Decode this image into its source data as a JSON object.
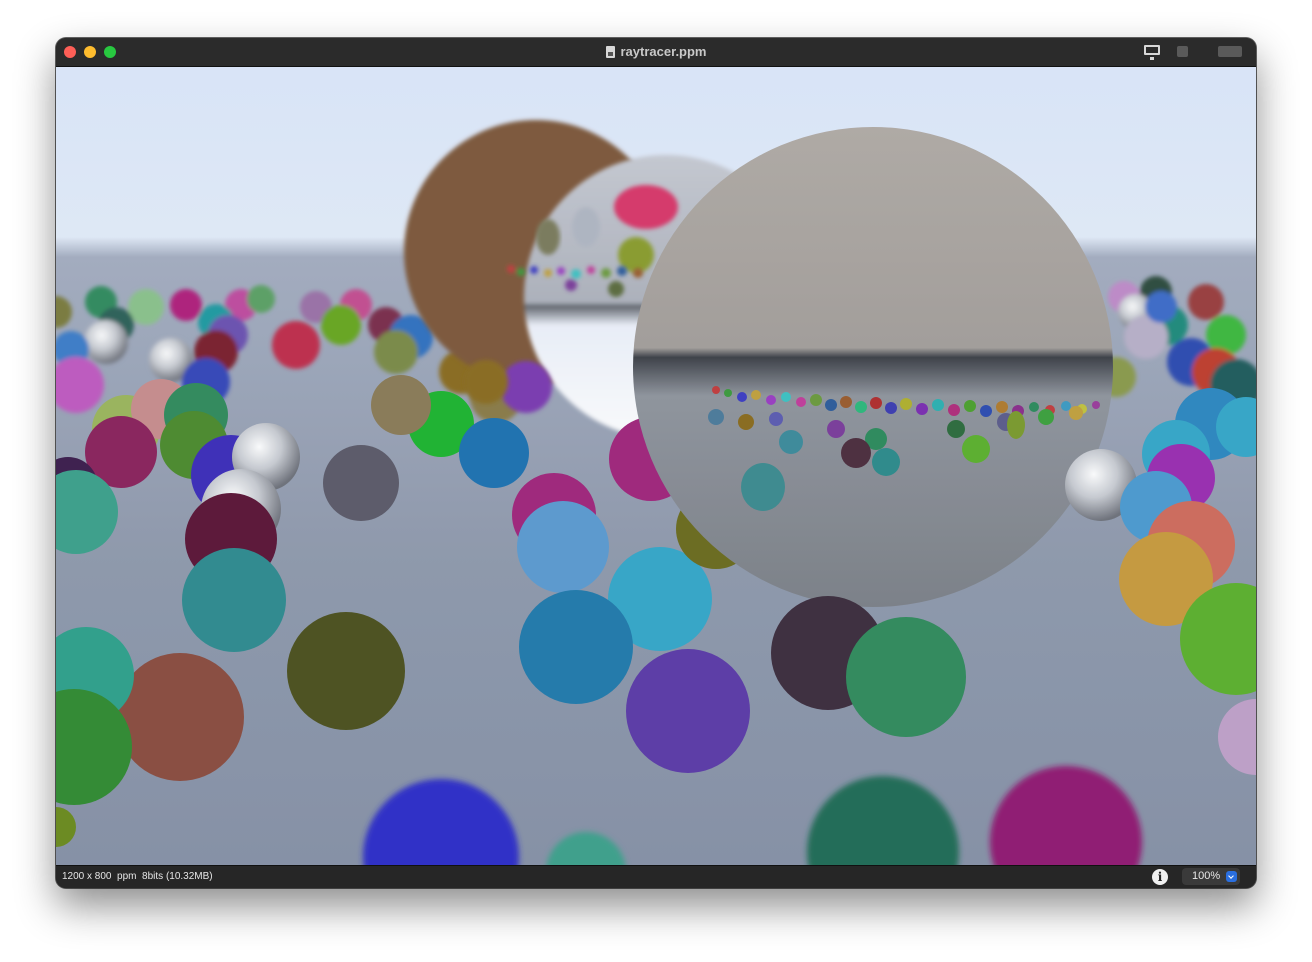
{
  "window": {
    "title": "raytracer.ppm",
    "traffic_lights": [
      "close",
      "minimize",
      "zoom"
    ],
    "toolbar_icons": [
      "monitor-icon",
      "sidebar-toggle-icon",
      "view-mode-icon"
    ]
  },
  "image": {
    "description_icon": "rendered-spheres-image",
    "colors": {
      "sky": "#dde8fb",
      "ground": "#8e98ab"
    }
  },
  "statusbar": {
    "info": "1200 x 800  ppm  8bits (10.32MB)",
    "info_icon": "info-icon",
    "zoom": "100%"
  }
}
